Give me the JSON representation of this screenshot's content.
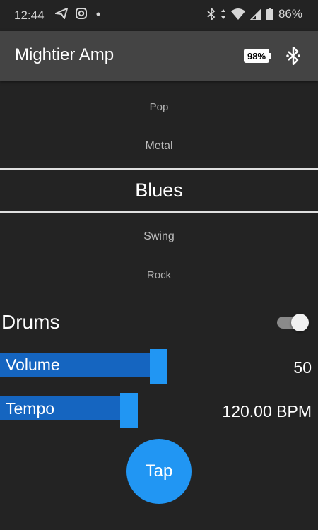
{
  "status_bar": {
    "time": "12:44",
    "battery_percent": "86%",
    "left_icons": [
      "send-icon",
      "instagram-icon",
      "dot-icon"
    ],
    "right_icons": [
      "bluetooth-icon",
      "data-arrows-icon",
      "wifi-icon",
      "signal-icon",
      "battery-icon"
    ]
  },
  "app_bar": {
    "title": "Mightier Amp",
    "device_battery": "98%",
    "icons": [
      "battery-badge-icon",
      "bluetooth-icon"
    ]
  },
  "genres": {
    "items": [
      "Pop",
      "Metal",
      "Blues",
      "Swing",
      "Rock"
    ],
    "selected": "Blues"
  },
  "drums": {
    "label": "Drums",
    "enabled": true
  },
  "volume": {
    "label": "Volume",
    "value": "50",
    "level_fraction": 0.5
  },
  "tempo": {
    "label": "Tempo",
    "value": "120.00 BPM",
    "level_fraction": 0.41
  },
  "tap_button": {
    "label": "Tap"
  },
  "colors": {
    "background": "#232323",
    "app_bar": "#444444",
    "accent": "#2196f3",
    "slider_fill": "#1565c0"
  }
}
